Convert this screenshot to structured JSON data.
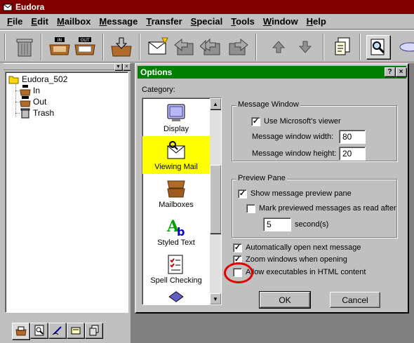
{
  "app": {
    "title": "Eudora"
  },
  "menu": [
    "File",
    "Edit",
    "Mailbox",
    "Message",
    "Transfer",
    "Special",
    "Tools",
    "Window",
    "Help"
  ],
  "toolbar": {
    "icons": [
      "trash-icon",
      "inbox-icon",
      "outbox-icon",
      "check-mail-icon",
      "new-message-icon",
      "reply-icon",
      "reply-all-icon",
      "forward-icon",
      "previous-icon",
      "next-icon",
      "attach-icon",
      "find-icon",
      "options-icon"
    ],
    "in_label": "IN",
    "out_label": "OUT"
  },
  "mailboxes": {
    "root": "Eudora_502",
    "items": [
      "In",
      "Out",
      "Trash"
    ]
  },
  "dialog": {
    "title": "Options",
    "help_btn": "?",
    "close_btn": "×",
    "category_label": "Category:",
    "categories": [
      "Display",
      "Viewing Mail",
      "Mailboxes",
      "Styled Text",
      "Spell Checking"
    ],
    "selected_category": "Viewing Mail",
    "message_window": {
      "title": "Message Window",
      "use_viewer": "Use Microsoft's viewer",
      "use_viewer_checked": true,
      "width_label": "Message window width:",
      "width_value": "80",
      "height_label": "Message window height:",
      "height_value": "20"
    },
    "preview_pane": {
      "title": "Preview Pane",
      "show_preview": "Show message preview pane",
      "show_preview_checked": true,
      "mark_read": "Mark previewed messages as read after",
      "mark_read_checked": false,
      "seconds_value": "5",
      "seconds_label": "second(s)"
    },
    "auto_open": "Automatically open next message",
    "auto_open_checked": true,
    "zoom": "Zoom windows when opening",
    "zoom_checked": true,
    "allow_exec": "Allow executables in HTML content",
    "allow_exec_checked": false,
    "ok": "OK",
    "cancel": "Cancel"
  },
  "colors": {
    "titlebar": "#800000",
    "dialog_title": "#008000",
    "selected": "#ffff00",
    "highlight": "#e00000"
  }
}
